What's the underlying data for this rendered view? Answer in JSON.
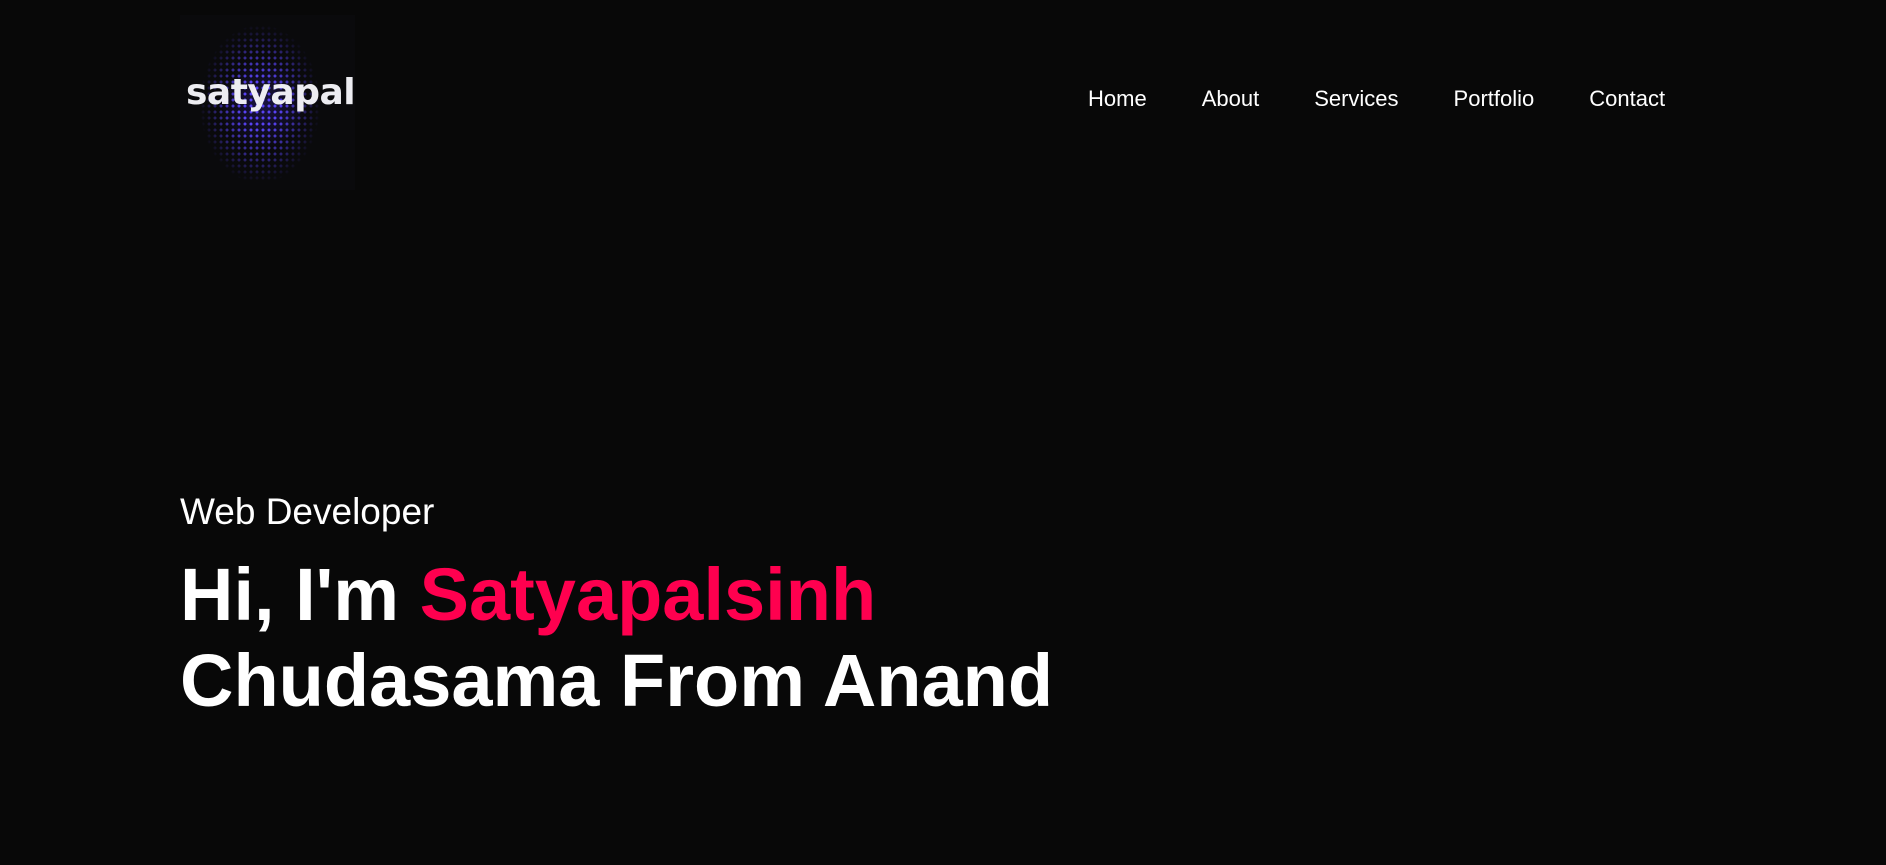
{
  "brand": {
    "logo_text": "satyapal"
  },
  "nav": {
    "items": [
      {
        "label": "Home"
      },
      {
        "label": "About"
      },
      {
        "label": "Services"
      },
      {
        "label": "Portfolio"
      },
      {
        "label": "Contact"
      }
    ]
  },
  "hero": {
    "subtitle": "Web Developer",
    "greeting": "Hi, I'm ",
    "highlight_name": "Satyapalsinh",
    "line2": "Chudasama From Anand"
  },
  "colors": {
    "background": "#080808",
    "text": "#ffffff",
    "accent": "#ff004f",
    "logo_dots": "#5c46ff"
  }
}
